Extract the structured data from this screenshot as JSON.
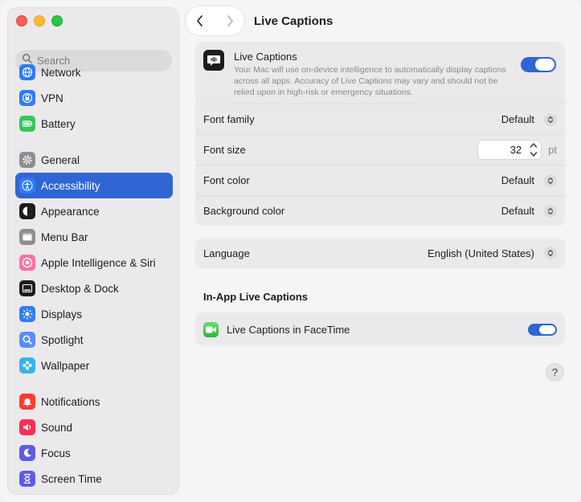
{
  "window": {
    "title": "Live Captions"
  },
  "sidebar": {
    "search_placeholder": "Search",
    "group1": [
      {
        "label": "Network",
        "icon": "network-icon",
        "color": "#2f7cf6"
      },
      {
        "label": "VPN",
        "icon": "vpn-icon",
        "color": "#2f7cf6"
      },
      {
        "label": "Battery",
        "icon": "battery-icon",
        "color": "#34c759"
      }
    ],
    "group2": [
      {
        "label": "General",
        "icon": "gear-icon",
        "color": "#8e8e93"
      },
      {
        "label": "Accessibility",
        "icon": "accessibility-icon",
        "color": "#2f7cf6",
        "active": true
      },
      {
        "label": "Appearance",
        "icon": "appearance-icon",
        "color": "#1c1c1e"
      },
      {
        "label": "Menu Bar",
        "icon": "menubar-icon",
        "color": "#8e8e93"
      },
      {
        "label": "Apple Intelligence & Siri",
        "icon": "siri-icon",
        "color": "#ff6fa3"
      },
      {
        "label": "Desktop & Dock",
        "icon": "dock-icon",
        "color": "#1c1c1e"
      },
      {
        "label": "Displays",
        "icon": "displays-icon",
        "color": "#2f7cf6"
      },
      {
        "label": "Spotlight",
        "icon": "spotlight-icon",
        "color": "#5b8ef6"
      },
      {
        "label": "Wallpaper",
        "icon": "wallpaper-icon",
        "color": "#35b3f0"
      }
    ],
    "group3": [
      {
        "label": "Notifications",
        "icon": "notifications-icon",
        "color": "#ff3b30"
      },
      {
        "label": "Sound",
        "icon": "sound-icon",
        "color": "#ff2d55"
      },
      {
        "label": "Focus",
        "icon": "focus-icon",
        "color": "#5e5ce6"
      },
      {
        "label": "Screen Time",
        "icon": "screentime-icon",
        "color": "#5e5ce6"
      }
    ]
  },
  "main": {
    "title": "Live Captions",
    "live_captions": {
      "title": "Live Captions",
      "description": "Your Mac will use on-device intelligence to automatically display captions across all apps. Accuracy of Live Captions may vary and should not be relied upon in high-risk or emergency situations.",
      "enabled": true
    },
    "font_family": {
      "label": "Font family",
      "value": "Default"
    },
    "font_size": {
      "label": "Font size",
      "value": "32",
      "unit": "pt"
    },
    "font_color": {
      "label": "Font color",
      "value": "Default"
    },
    "background_color": {
      "label": "Background color",
      "value": "Default"
    },
    "language": {
      "label": "Language",
      "value": "English (United States)"
    },
    "in_app_title": "In-App Live Captions",
    "facetime": {
      "label": "Live Captions in FaceTime",
      "enabled": true
    },
    "help_label": "?"
  }
}
